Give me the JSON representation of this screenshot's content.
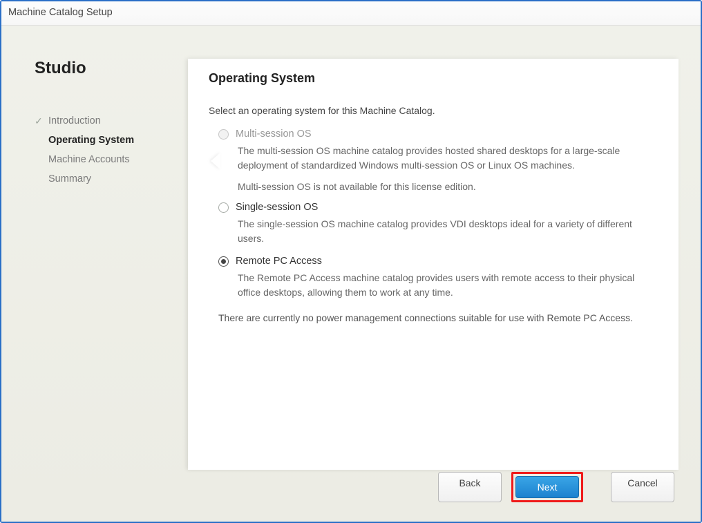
{
  "window": {
    "title": "Machine Catalog Setup"
  },
  "sidebar": {
    "product": "Studio",
    "items": [
      {
        "label": "Introduction",
        "state": "completed"
      },
      {
        "label": "Operating System",
        "state": "current"
      },
      {
        "label": "Machine Accounts",
        "state": "pending"
      },
      {
        "label": "Summary",
        "state": "pending"
      }
    ]
  },
  "panel": {
    "heading": "Operating System",
    "instruction": "Select an operating system for this Machine Catalog.",
    "options": [
      {
        "id": "multi",
        "label": "Multi-session OS",
        "disabled": true,
        "selected": false,
        "description": "The multi-session OS machine catalog provides hosted shared desktops for a large-scale deployment of standardized Windows multi-session OS or Linux OS machines.",
        "note": "Multi-session OS is not available for this license edition."
      },
      {
        "id": "single",
        "label": "Single-session OS",
        "disabled": false,
        "selected": false,
        "description": "The single-session OS machine catalog provides VDI desktops ideal for a variety of different users."
      },
      {
        "id": "remote",
        "label": "Remote PC Access",
        "disabled": false,
        "selected": true,
        "description": "The Remote PC Access machine catalog provides users with remote access to their physical office desktops, allowing them to work at any time."
      }
    ],
    "footer_note": "There are currently no power management connections suitable for use with Remote PC Access."
  },
  "buttons": {
    "back": "Back",
    "next": "Next",
    "cancel": "Cancel"
  }
}
